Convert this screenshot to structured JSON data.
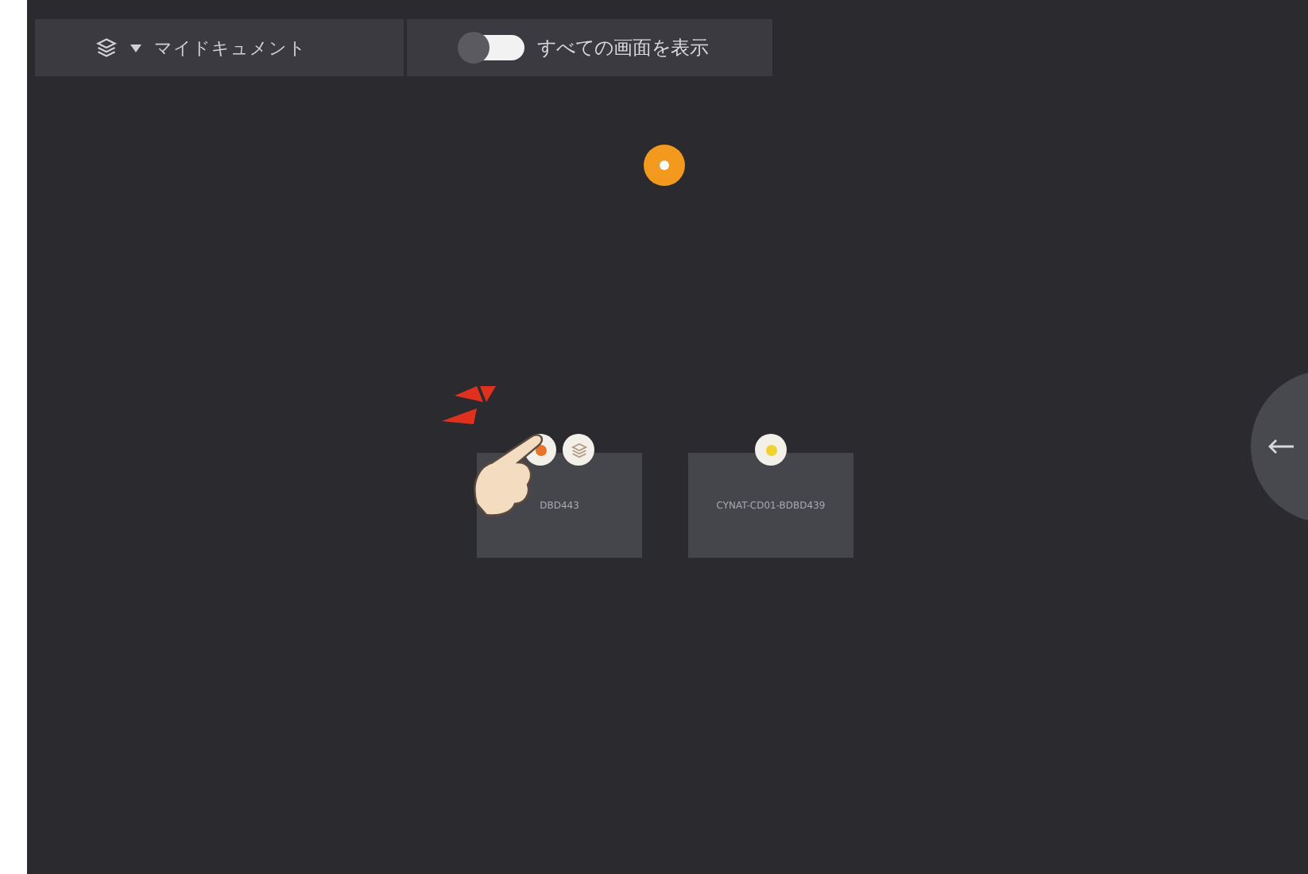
{
  "toolbar": {
    "document_menu": "マイドキュメント",
    "show_all_toggle": {
      "label": "すべての画面を表示",
      "on": false
    }
  },
  "canvas": {
    "floating_marker": {
      "color": "#f39a1e"
    },
    "cards": [
      {
        "label": "DBD443",
        "badges": [
          {
            "kind": "dot",
            "color": "#e8742a"
          },
          {
            "kind": "layers"
          }
        ],
        "tutorial_hand": true
      },
      {
        "label": "CYNAT-CD01-BDBD439",
        "badges": [
          {
            "kind": "dot",
            "color": "#f0d230"
          }
        ],
        "tutorial_hand": false
      }
    ]
  }
}
